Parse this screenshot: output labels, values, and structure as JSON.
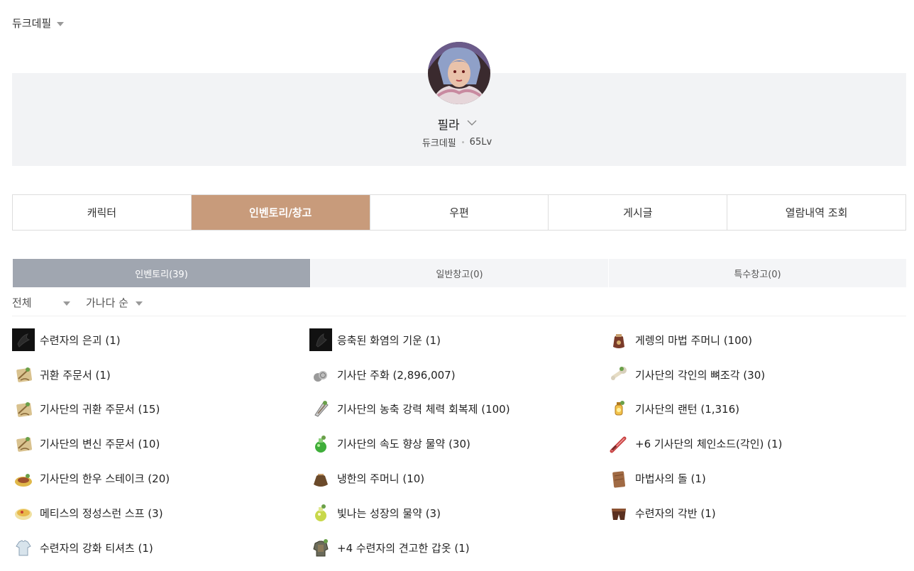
{
  "server": {
    "name": "듀크데필"
  },
  "character": {
    "name": "필라",
    "server": "듀크데필",
    "level": "65Lv"
  },
  "main_tabs": [
    {
      "label": "캐릭터"
    },
    {
      "label": "인벤토리/창고"
    },
    {
      "label": "우편"
    },
    {
      "label": "게시글"
    },
    {
      "label": "열람내역 조회"
    }
  ],
  "sub_tabs": [
    {
      "label": "인벤토리(39)"
    },
    {
      "label": "일반창고(0)"
    },
    {
      "label": "특수창고(0)"
    }
  ],
  "filters": {
    "category": "전체",
    "sort": "가나다 순"
  },
  "items": [
    {
      "label": "수련자의 은괴 (1)",
      "icon": "dark-ingot-icon"
    },
    {
      "label": "응축된 화염의 기운 (1)",
      "icon": "dark-flame-icon"
    },
    {
      "label": "게렝의 마법 주머니 (100)",
      "icon": "magic-pouch-icon"
    },
    {
      "label": "귀환 주문서 (1)",
      "icon": "scroll-icon"
    },
    {
      "label": "기사단 주화 (2,896,007)",
      "icon": "coins-icon"
    },
    {
      "label": "기사단의 각인의 뼈조각 (30)",
      "icon": "bone-icon"
    },
    {
      "label": "기사단의 귀환 주문서 (15)",
      "icon": "scroll-icon"
    },
    {
      "label": "기사단의 농축 강력 체력 회복제 (100)",
      "icon": "potion-vial-icon"
    },
    {
      "label": "기사단의 랜턴 (1,316)",
      "icon": "lantern-icon"
    },
    {
      "label": "기사단의 변신 주문서 (10)",
      "icon": "scroll-icon"
    },
    {
      "label": "기사단의 속도 향상 물약 (30)",
      "icon": "green-potion-icon"
    },
    {
      "label": "+6 기사단의 체인소드(각인) (1)",
      "icon": "chainsword-icon"
    },
    {
      "label": "기사단의 한우 스테이크 (20)",
      "icon": "steak-icon"
    },
    {
      "label": "냉한의 주머니 (10)",
      "icon": "pouch-icon"
    },
    {
      "label": "마법사의 돌 (1)",
      "icon": "stone-icon"
    },
    {
      "label": "메티스의 정성스런 스프 (3)",
      "icon": "soup-icon"
    },
    {
      "label": "빛나는 성장의 물약 (3)",
      "icon": "glowing-potion-icon"
    },
    {
      "label": "수련자의 각반 (1)",
      "icon": "greaves-icon"
    },
    {
      "label": "수련자의 강화 티셔츠 (1)",
      "icon": "tshirt-icon"
    },
    {
      "label": "+4 수련자의 견고한 갑옷 (1)",
      "icon": "armor-icon"
    }
  ]
}
